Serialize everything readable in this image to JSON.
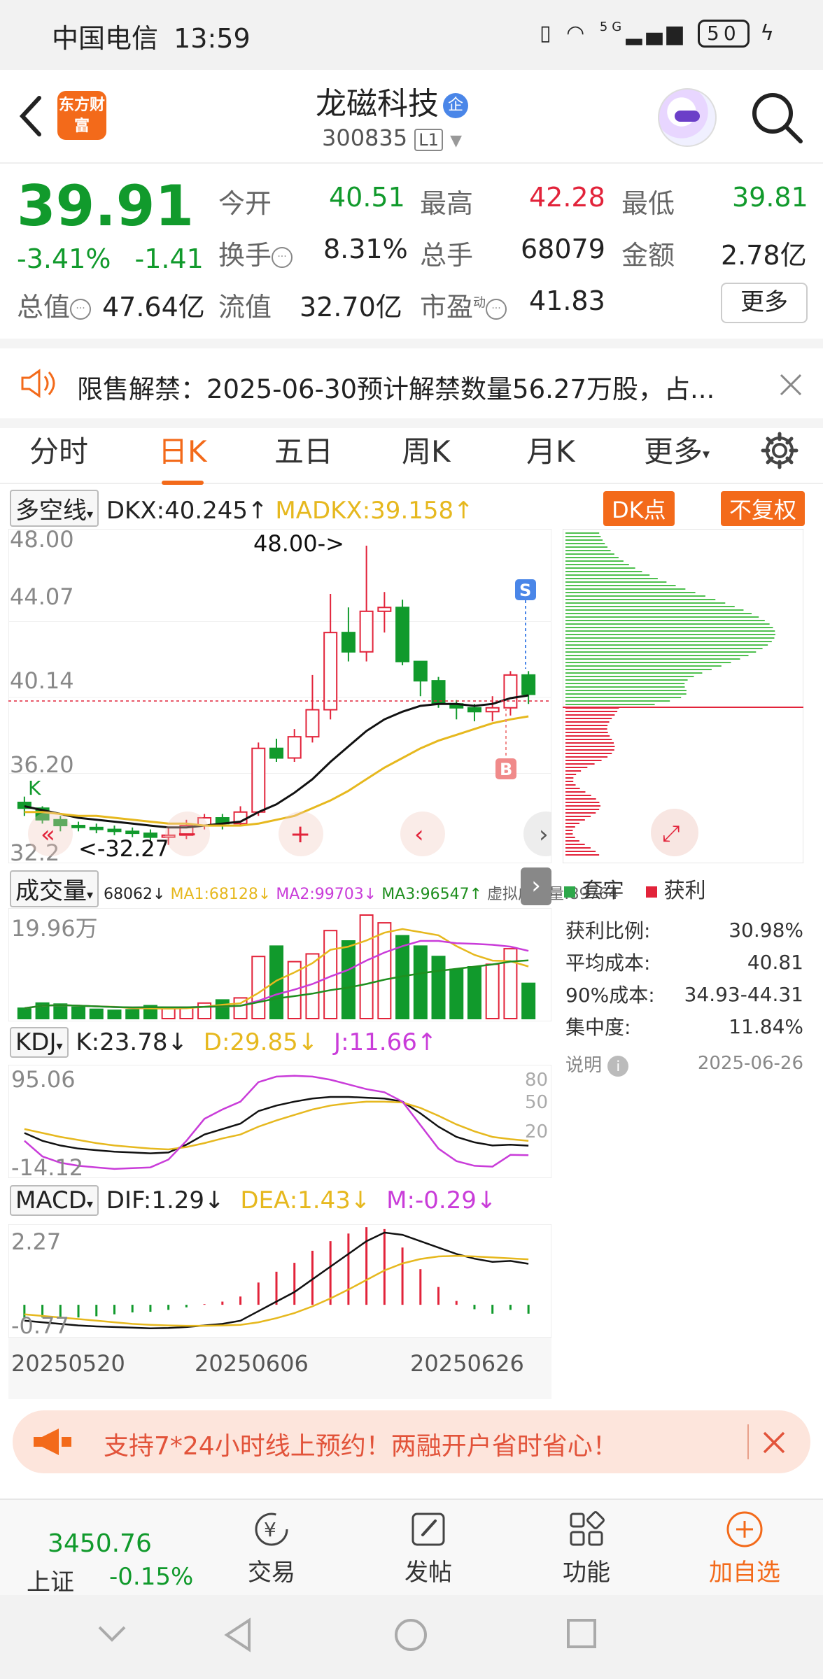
{
  "status_bar": {
    "carrier": "中国电信",
    "time": "13:59",
    "signal": "5G",
    "battery": "50"
  },
  "header": {
    "logo_text": "东方财富",
    "stock_name": "龙磁科技",
    "company_tag": "企",
    "stock_code": "300835",
    "level": "L1"
  },
  "quote": {
    "price": "39.91",
    "change_pct": "-3.41%",
    "change_amt": "-1.41",
    "open_label": "今开",
    "open": "40.51",
    "high_label": "最高",
    "high": "42.28",
    "low_label": "最低",
    "low": "39.81",
    "turnover_label": "换手",
    "turnover": "8.31%",
    "volume_label": "总手",
    "volume": "68079",
    "amount_label": "金额",
    "amount": "2.78亿",
    "mktcap_label": "总值",
    "mktcap": "47.64亿",
    "float_label": "流值",
    "float_cap": "32.70亿",
    "pe_label": "市盈",
    "pe_sup": "动",
    "pe": "41.83",
    "more_button": "更多"
  },
  "notice": {
    "text": "限售解禁：2025-06-30预计解禁数量56.27万股，占..."
  },
  "tabs": [
    "分时",
    "日K",
    "五日",
    "周K",
    "月K",
    "更多"
  ],
  "active_tab": "日K",
  "indicators": {
    "dkx_select": "多空线",
    "dkx": "DKX:40.245↑",
    "madkx": "MADKX:39.158↑",
    "dk_button": "DK点",
    "fq_button": "不复权",
    "vol_select": "成交量",
    "vol_value": "68062↓",
    "ma1": "MA1:68128↓",
    "ma2": "MA2:99703↓",
    "ma3": "MA3:96547↑",
    "virtual": "虚拟成交量:89764",
    "kdj_select": "KDJ",
    "k": "K:23.78↓",
    "d": "D:29.85↓",
    "j": "J:11.66↑",
    "macd_select": "MACD",
    "dif": "DIF:1.29↓",
    "dea": "DEA:1.43↓",
    "m": "M:-0.29↓"
  },
  "price_chart": {
    "y_labels": [
      "48.00",
      "44.07",
      "40.14",
      "36.20",
      "32.2"
    ],
    "max_annotation": "48.00->",
    "min_annotation": "<-32.27",
    "s_marker": "S",
    "b_marker": "B",
    "k_marker": "K"
  },
  "volume_chart": {
    "y_label": "19.96万"
  },
  "kdj_chart": {
    "y_top": "95.06",
    "y_bottom": "-14.12",
    "levels": [
      "80",
      "50",
      "20"
    ]
  },
  "macd_chart": {
    "y_top": "2.27",
    "y_bottom": "-0.77"
  },
  "dates": [
    "20250520",
    "20250606",
    "20250626"
  ],
  "chip": {
    "legend_trapped": "套牢",
    "legend_profit": "获利",
    "rows": [
      {
        "label": "获利比例:",
        "value": "30.98%"
      },
      {
        "label": "平均成本:",
        "value": "40.81"
      },
      {
        "label": "90%成本:",
        "value": "34.93-44.31"
      },
      {
        "label": "集中度:",
        "value": "11.84%"
      }
    ],
    "note_label": "说明",
    "note_date": "2025-06-26"
  },
  "promo": {
    "text": "支持7*24小时线上预约！两融开户省时省心！"
  },
  "bottom_nav": {
    "index_value": "3450.76",
    "index_name": "上证",
    "index_change": "-0.15%",
    "items": [
      "交易",
      "发帖",
      "功能",
      "加自选"
    ]
  },
  "chart_data": {
    "type": "candlestick",
    "ylim": [
      32.27,
      48.0
    ],
    "candles": [
      [
        34.7,
        34.4,
        35.0,
        34.0
      ],
      [
        34.4,
        33.8,
        34.5,
        33.6
      ],
      [
        33.8,
        33.5,
        34.0,
        33.2
      ],
      [
        33.5,
        33.4,
        33.7,
        33.2
      ],
      [
        33.4,
        33.3,
        33.6,
        33.1
      ],
      [
        33.3,
        33.2,
        33.5,
        33.0
      ],
      [
        33.2,
        33.1,
        33.4,
        32.9
      ],
      [
        33.1,
        32.9,
        33.3,
        32.6
      ],
      [
        32.9,
        33.0,
        33.4,
        32.5
      ],
      [
        33.0,
        33.5,
        33.8,
        32.8
      ],
      [
        33.5,
        33.9,
        34.1,
        33.3
      ],
      [
        33.9,
        33.6,
        34.1,
        33.3
      ],
      [
        33.6,
        34.2,
        34.5,
        33.5
      ],
      [
        34.2,
        37.5,
        37.8,
        34.0
      ],
      [
        37.5,
        37.0,
        38.0,
        36.8
      ],
      [
        37.0,
        38.1,
        38.5,
        36.8
      ],
      [
        38.1,
        39.5,
        41.3,
        37.8
      ],
      [
        39.5,
        43.5,
        45.5,
        39.0
      ],
      [
        43.5,
        42.5,
        44.8,
        42.0
      ],
      [
        42.5,
        44.6,
        48.0,
        42.0
      ],
      [
        44.6,
        44.8,
        45.6,
        43.5
      ],
      [
        44.8,
        42.0,
        45.2,
        41.8
      ],
      [
        42.0,
        41.0,
        41.8,
        40.2
      ],
      [
        41.0,
        39.8,
        41.2,
        39.6
      ],
      [
        39.8,
        39.6,
        40.0,
        39.0
      ],
      [
        39.6,
        39.4,
        39.8,
        38.9
      ],
      [
        39.4,
        39.6,
        40.2,
        38.9
      ],
      [
        39.6,
        41.3,
        41.5,
        39.2
      ],
      [
        41.3,
        40.3,
        41.5,
        39.8
      ]
    ],
    "dkx": [
      34.5,
      34.3,
      34.1,
      33.9,
      33.8,
      33.7,
      33.6,
      33.5,
      33.4,
      33.4,
      33.5,
      33.6,
      33.7,
      34.2,
      34.6,
      35.2,
      35.9,
      36.8,
      37.6,
      38.4,
      39.0,
      39.4,
      39.7,
      39.8,
      39.8,
      39.7,
      39.8,
      40.1,
      40.245
    ],
    "madkx": [
      34.2,
      34.2,
      34.1,
      34.0,
      34.0,
      33.9,
      33.8,
      33.7,
      33.6,
      33.6,
      33.5,
      33.5,
      33.5,
      33.6,
      33.8,
      34.0,
      34.4,
      34.8,
      35.3,
      35.9,
      36.5,
      37.0,
      37.5,
      37.9,
      38.2,
      38.5,
      38.8,
      39.0,
      39.158
    ],
    "volume": [
      20000,
      30000,
      28000,
      22000,
      18000,
      16000,
      17000,
      25000,
      20000,
      22000,
      30000,
      36000,
      40000,
      120000,
      140000,
      110000,
      125000,
      170000,
      150000,
      200000,
      185000,
      160000,
      140000,
      120000,
      95000,
      100000,
      105000,
      135000,
      68062
    ],
    "kdj": {
      "k": [
        40,
        30,
        24,
        20,
        18,
        16,
        15,
        14,
        15,
        25,
        38,
        45,
        52,
        68,
        75,
        80,
        84,
        86,
        86,
        85,
        84,
        80,
        65,
        48,
        35,
        28,
        24,
        25,
        23.78
      ],
      "d": [
        45,
        40,
        35,
        31,
        27,
        24,
        22,
        20,
        19,
        22,
        27,
        33,
        38,
        48,
        56,
        63,
        70,
        75,
        78,
        80,
        80,
        79,
        72,
        62,
        51,
        42,
        35,
        32,
        29.85
      ],
      "j": [
        30,
        10,
        2,
        -2,
        -4,
        -6,
        -5,
        -4,
        6,
        30,
        58,
        70,
        80,
        105,
        112,
        113,
        112,
        108,
        102,
        96,
        92,
        80,
        50,
        20,
        4,
        -2,
        -3,
        12,
        11.66
      ]
    },
    "macd": {
      "dif": [
        -0.5,
        -0.55,
        -0.6,
        -0.65,
        -0.68,
        -0.7,
        -0.72,
        -0.74,
        -0.73,
        -0.7,
        -0.65,
        -0.6,
        -0.5,
        -0.2,
        0.1,
        0.4,
        0.8,
        1.2,
        1.6,
        2.0,
        2.27,
        2.2,
        2.0,
        1.8,
        1.6,
        1.45,
        1.35,
        1.38,
        1.29
      ],
      "dea": [
        -0.3,
        -0.35,
        -0.4,
        -0.45,
        -0.5,
        -0.55,
        -0.6,
        -0.63,
        -0.65,
        -0.66,
        -0.66,
        -0.65,
        -0.63,
        -0.55,
        -0.42,
        -0.26,
        -0.05,
        0.2,
        0.48,
        0.78,
        1.08,
        1.3,
        1.44,
        1.52,
        1.54,
        1.52,
        1.49,
        1.46,
        1.43
      ]
    },
    "colors": {
      "up": "#e2233a",
      "down": "#119a2c",
      "dkx": "#111111",
      "madkx": "#e6b81e",
      "ma2": "#c93cd9",
      "ma3": "#1f8f1f"
    }
  }
}
